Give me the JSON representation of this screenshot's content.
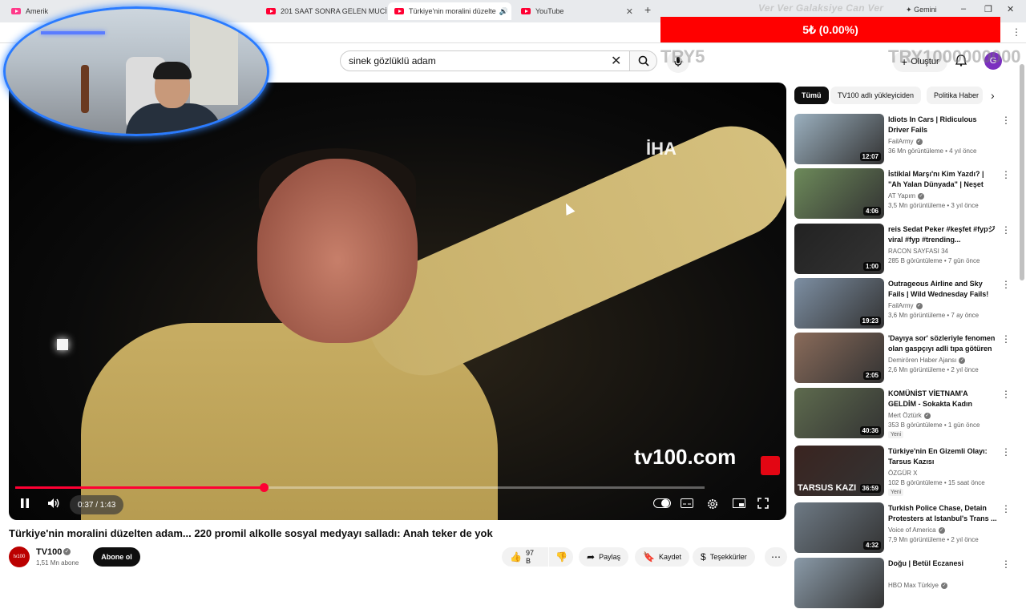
{
  "browser": {
    "tabs": [
      {
        "title": "Amerik",
        "active": false
      },
      {
        "title": "201 SAAT SONRA GELEN MUCİ",
        "active": false
      },
      {
        "title": "Türkiye'nin moralini düzelte",
        "active": true
      },
      {
        "title": "YouTube",
        "active": false
      }
    ],
    "profile_label": "Gemini",
    "new_tab": "+",
    "window_controls": [
      "–",
      "❐",
      "✕"
    ]
  },
  "overlay": {
    "donation_title": "Ver Ver Galaksiye Can Ver",
    "donation_value": "5₺ (0.00%)",
    "currency_small": "TRY5",
    "currency_big": "TRY1000000000"
  },
  "header": {
    "search_value": "sinek gözlüklü adam",
    "create_label": "Oluştur",
    "avatar_letter": "G"
  },
  "player": {
    "time": "0:37 / 1:43",
    "progress": 0.36,
    "iha_logo": "İHA",
    "tv100_logo_a": "tv100",
    "tv100_logo_b": ".com"
  },
  "video": {
    "title": "Türkiye'nin moralini düzelten adam... 220 promil alkolle sosyal medyayı salladı: Anah teker de yok",
    "channel": "TV100",
    "subscribers": "1,51 Mn abone",
    "subscribe_label": "Abone ol",
    "likes": "97 B",
    "share_label": "Paylaş",
    "save_label": "Kaydet",
    "thanks_label": "Teşekkürler",
    "avatar_text": "tv100"
  },
  "chips": [
    "Tümü",
    "TV100 adlı yükleyiciden",
    "Politika Haber"
  ],
  "recommendations": [
    {
      "title": "Idiots In Cars | Ridiculous Driver Fails",
      "channel": "FailArmy",
      "verified": true,
      "meta": "36 Mn görüntüleme • 4 yıl önce",
      "duration": "12:07",
      "badge": "",
      "color": "#9bb0bf"
    },
    {
      "title": "İstiklal Marşı'nı Kim Yazdı? | \"Ah Yalan Dünyada\" | Neşet Ertaş ...",
      "channel": "AT Yapım",
      "verified": true,
      "meta": "3,5 Mn görüntüleme • 3 yıl önce",
      "duration": "4:06",
      "badge": "",
      "color": "#6d8a5a"
    },
    {
      "title": "reis Sedat Peker #keşfet #fypジ viral #fyp #trending...",
      "channel": "RACON SAYFASI 34",
      "verified": false,
      "meta": "285 B görüntüleme • 7 gün önce",
      "duration": "1:00",
      "badge": "",
      "color": "#222222"
    },
    {
      "title": "Outrageous Airline and Sky Fails | Wild Wednesday Fails!",
      "channel": "FailArmy",
      "verified": true,
      "meta": "3,6 Mn görüntüleme • 7 ay önce",
      "duration": "19:23",
      "badge": "",
      "color": "#7d8fa3"
    },
    {
      "title": "'Dayıya sor' sözleriyle fenomen olan gaspçıyı adli tıpa götüren ...",
      "channel": "Demirören Haber Ajansı",
      "verified": true,
      "meta": "2,6 Mn görüntüleme • 2 yıl önce",
      "duration": "2:05",
      "badge": "",
      "color": "#8a6b5a"
    },
    {
      "title": "KOMÜNİST VİETNAM'A GELDİM - Sokakta Kadın Berber ve ...",
      "channel": "Mert Öztürk",
      "verified": true,
      "meta": "353 B görüntüleme • 1 gün önce",
      "duration": "40:36",
      "badge": "Yeni",
      "color": "#5e6b4e"
    },
    {
      "title": "Türkiye'nin En Gizemli Olayı: Tarsus Kazısı",
      "channel": "ÖZGÜR X",
      "verified": false,
      "meta": "102 B görüntüleme • 15 saat önce",
      "duration": "36:59",
      "badge": "Yeni",
      "color": "#3a2420",
      "thumb_text": "TARSUS KAZI"
    },
    {
      "title": "Turkish Police Chase, Detain Protesters at Istanbul's Trans ...",
      "channel": "Voice of America",
      "verified": true,
      "meta": "7,9 Mn görüntüleme • 2 yıl önce",
      "duration": "4:32",
      "badge": "",
      "color": "#6e7a85"
    },
    {
      "title": "Doğu | Betül Eczanesi",
      "channel": "HBO Max Türkiye",
      "verified": true,
      "meta": "",
      "duration": "",
      "badge": "",
      "color": "#8a9aa8"
    }
  ]
}
